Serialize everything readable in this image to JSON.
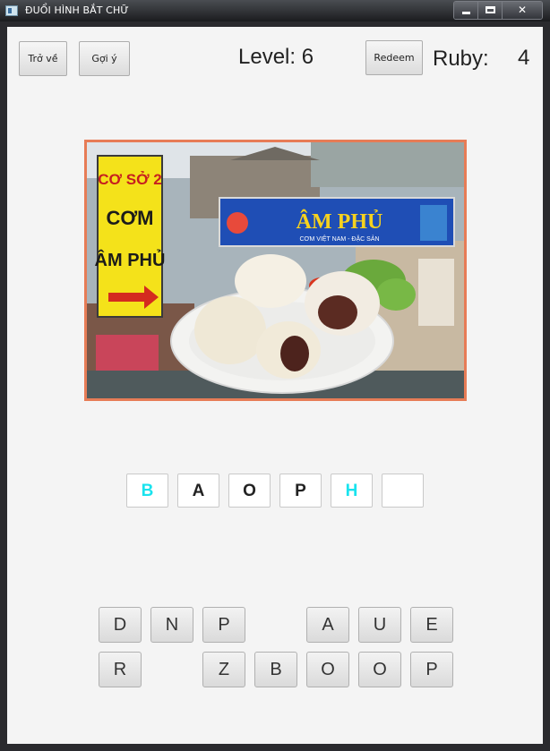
{
  "window": {
    "title": "ĐUỔI HÌNH BẮT CHỮ",
    "controls": {
      "minimize_icon": "minimize-icon",
      "maximize_icon": "maximize-icon",
      "close_glyph": "✕"
    }
  },
  "toolbar": {
    "back_label": "Trở về",
    "hint_label": "Gợi ý",
    "level_text": "Level: 6",
    "redeem_label": "Redeem",
    "ruby_label": "Ruby:",
    "ruby_value": "4"
  },
  "puzzle": {
    "image_semantic": "puzzle-photo (shop signs 'CƠ SỞ 2 CƠM ÂM PHỦ' with plate of steamed buns)",
    "sign_left_lines": [
      "CƠ SỞ 2",
      "CƠM",
      "ÂM PHỦ"
    ],
    "sign_right_line": "ÂM PHỦ",
    "sign_right_small": "CƠM VIỆT NAM - ĐẶC SẢN",
    "colors": {
      "hint_letter": "#19e3ee",
      "normal_letter": "#222222",
      "frame": "#e77c56"
    }
  },
  "answer_slots": [
    {
      "letter": "B",
      "hinted": true
    },
    {
      "letter": "A",
      "hinted": false
    },
    {
      "letter": "O",
      "hinted": false
    },
    {
      "letter": "P",
      "hinted": false
    },
    {
      "letter": "H",
      "hinted": true
    },
    {
      "letter": "",
      "hinted": false
    }
  ],
  "letter_keys": {
    "row1": [
      "D",
      "N",
      "P",
      "",
      "A",
      "U",
      "E"
    ],
    "row2": [
      "R",
      "",
      "Z",
      "B",
      "O",
      "O",
      "P"
    ]
  }
}
